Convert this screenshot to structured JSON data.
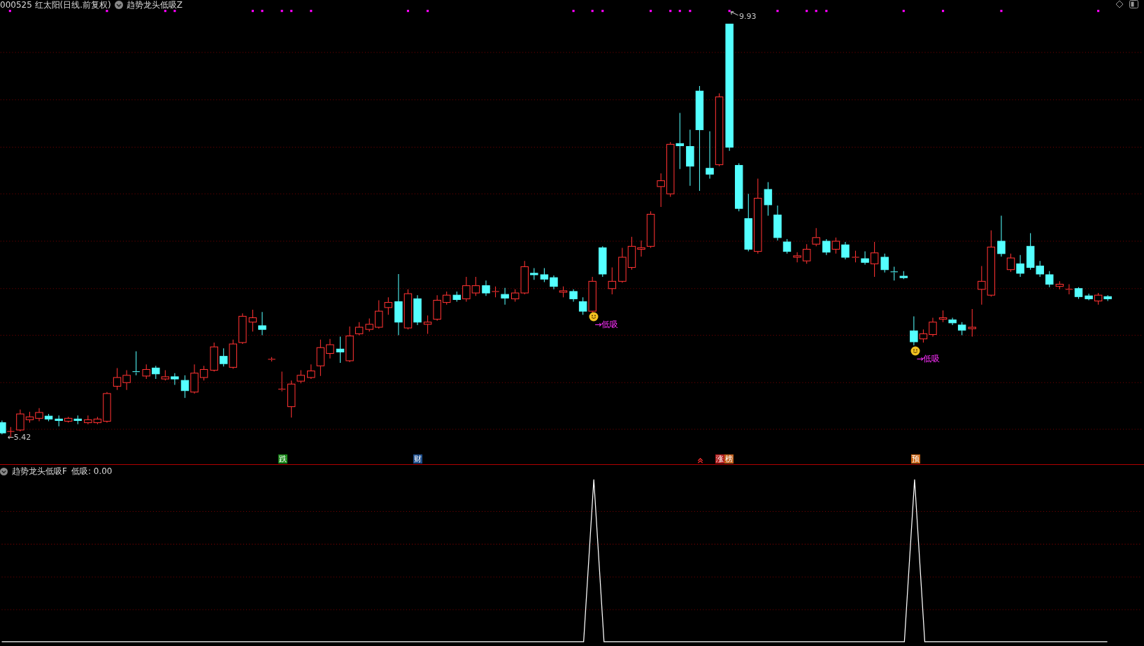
{
  "header": {
    "symbol": "000525 红太阳(日线.前复权)",
    "indicator": "趋势龙头低吸Z"
  },
  "price_chart": {
    "high_label": "9.93",
    "low_label": "←5.42",
    "signals": [
      {
        "text": "→低吸"
      },
      {
        "text": "→低吸"
      }
    ],
    "tags": [
      {
        "text": "跌",
        "color": "#1c8a1c"
      },
      {
        "text": "财",
        "color": "#1e4e8c"
      },
      {
        "text": "涨",
        "color": "#b01c1c"
      },
      {
        "text": "榜",
        "color": "#c0601c"
      },
      {
        "text": "预",
        "color": "#c86414"
      }
    ]
  },
  "indicator_pane": {
    "name": "趋势龙头低吸F",
    "reading": "低吸: 0.00"
  }
}
